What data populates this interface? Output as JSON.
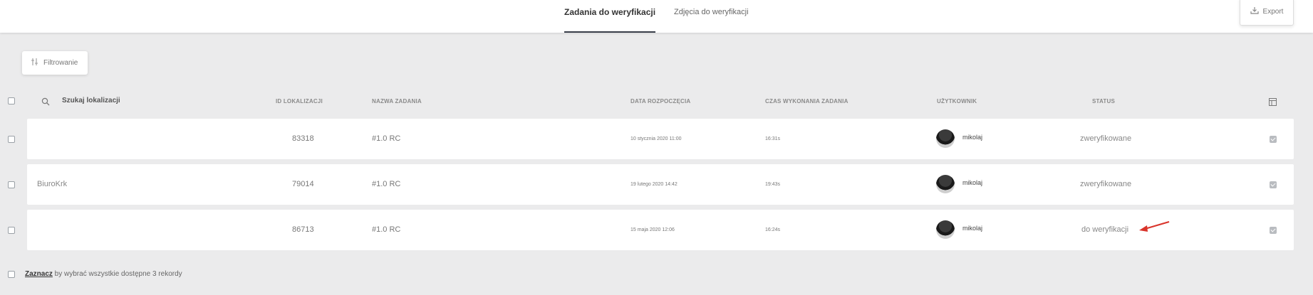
{
  "tabs": [
    {
      "label": "Zadania do weryfikacji",
      "active": true
    },
    {
      "label": "Zdjęcia do weryfikacji",
      "active": false
    }
  ],
  "export": {
    "label": "Export",
    "icon": "download-icon"
  },
  "filter": {
    "label": "Filtrowanie",
    "icon": "filter-sliders-icon"
  },
  "table": {
    "search_placeholder": "Szukaj lokalizacji",
    "columns": {
      "id": "ID LOKALIZACJI",
      "name": "NAZWA ZADANIA",
      "start": "DATA ROZPOCZĘCIA",
      "duration": "CZAS WYKONANIA ZADANIA",
      "user": "UŻYTKOWNIK",
      "status": "STATUS"
    },
    "rows": [
      {
        "location": "",
        "id": "83318",
        "name": "#1.0 RC",
        "start": "10 stycznia 2020 11:00",
        "duration": "16:31s",
        "user": "mikolaj",
        "status": "zweryfikowane"
      },
      {
        "location": "BiuroKrk",
        "id": "79014",
        "name": "#1.0 RC",
        "start": "19 lutego 2020 14:42",
        "duration": "19:43s",
        "user": "mikolaj",
        "status": "zweryfikowane"
      },
      {
        "location": "",
        "id": "86713",
        "name": "#1.0 RC",
        "start": "15 maja 2020 12:06",
        "duration": "16:24s",
        "user": "mikolaj",
        "status": "do weryfikacji"
      }
    ]
  },
  "footer": {
    "link": "Zaznacz",
    "text": " by wybrać wszystkie dostępne 3 rekordy"
  },
  "colors": {
    "arrow": "#d9342b",
    "background": "#ebebec",
    "active_tab_underline": "#3a3f4a"
  }
}
